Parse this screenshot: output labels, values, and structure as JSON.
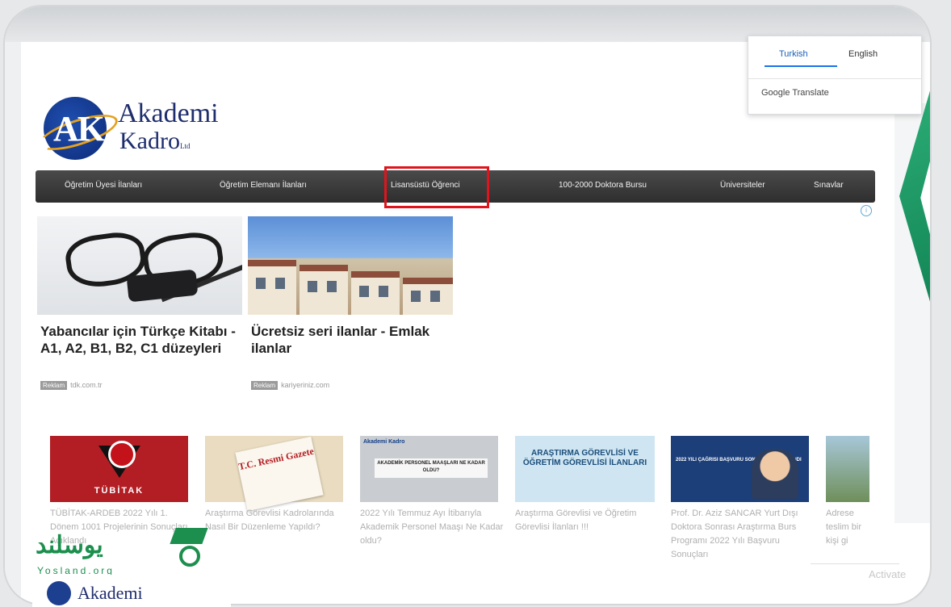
{
  "translate": {
    "tab_turkish": "Turkish",
    "tab_english": "English",
    "provider": "Google Translate"
  },
  "logo": {
    "letters": "AK",
    "word1": "Akademi",
    "word2": "Kadro",
    "suffix": "Ltd"
  },
  "nav": {
    "items": [
      "Öğretim Üyesi İlanları",
      "Öğretim Elemanı İlanları",
      "Lisansüstü Öğrenci",
      "100-2000 Doktora Bursu",
      "Üniversiteler",
      "Sınavlar"
    ]
  },
  "ads": [
    {
      "title": "Yabancılar için Türkçe Kitabı - A1, A2, B1, B2, C1 düzeyleri",
      "tag": "Reklam",
      "source": "tdk.com.tr"
    },
    {
      "title": "Ücretsiz seri ilanlar - Emlak ilanlar",
      "tag": "Reklam",
      "source": "kariyeriniz.com"
    }
  ],
  "news": [
    {
      "image_text": "TÜBİTAK",
      "caption": "TÜBİTAK-ARDEB 2022 Yılı 1. Dönem 1001 Projelerinin Sonuçları Açıklandı"
    },
    {
      "image_text": "T.C. Resmi Gazete",
      "caption": "Araştırma Görevlisi Kadrolarında Nasıl Bir Düzenleme Yapıldı?"
    },
    {
      "image_text": "AKADEMİK PERSONEL MAAŞLARI NE KADAR OLDU?",
      "logo_text": "Akademi Kadro",
      "caption": "2022 Yılı Temmuz Ayı İtibarıyla Akademik Personel Maaşı Ne Kadar oldu?"
    },
    {
      "image_text": "ARAŞTIRMA GÖREVLİSİ VE ÖĞRETİM GÖREVLİSİ İLANLARI",
      "caption": "Araştırma Görevlisi ve Öğretim Görevlisi İlanları !!!"
    },
    {
      "image_text": "2022 YILI ÇAĞRISI BAŞVURU SONUÇLARI AÇIKLANDI",
      "caption": "Prof. Dr. Aziz SANCAR Yurt Dışı Doktora Sonrası Araştırma Burs Programı 2022 Yılı Başvuru Sonuçları"
    },
    {
      "image_text": "",
      "caption": "Adrese teslim bir kişi gi"
    }
  ],
  "watermark": {
    "arabic": "يوسلند",
    "latin": "Yosland.org"
  },
  "bottom_logo": "Akademi",
  "os_notice": "Activate"
}
